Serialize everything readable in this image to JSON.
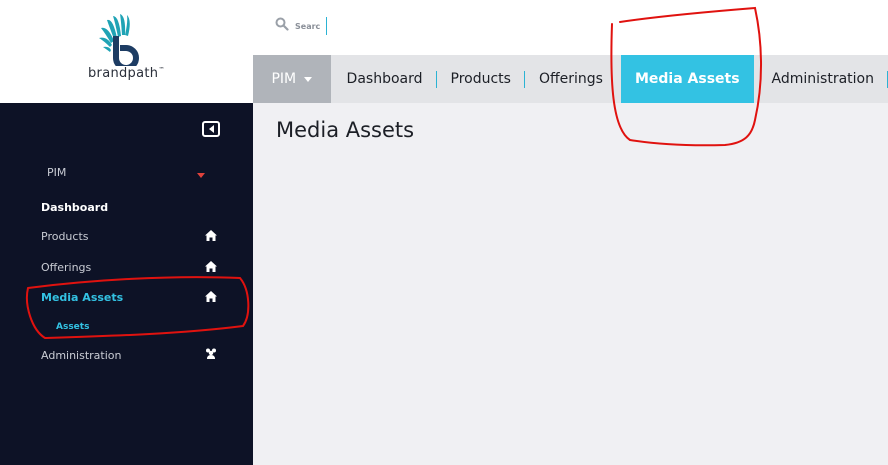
{
  "logo": {
    "text": "brandpath",
    "trademark": "™"
  },
  "search": {
    "placeholder": "Searc"
  },
  "nav": {
    "pim_label": "PIM",
    "items": [
      "Dashboard",
      "Products",
      "Offerings",
      "Media Assets",
      "Administration"
    ],
    "active": "Media Assets"
  },
  "sidebar": {
    "group_label": "PIM",
    "items": [
      {
        "label": "Dashboard",
        "icon": ""
      },
      {
        "label": "Products",
        "icon": "home-icon"
      },
      {
        "label": "Offerings",
        "icon": "home-icon"
      },
      {
        "label": "Media Assets",
        "icon": "home-icon"
      },
      {
        "label": "Administration",
        "icon": "users-icon"
      }
    ],
    "sub_item": "Assets"
  },
  "main": {
    "title": "Media Assets"
  },
  "colors": {
    "accent": "#33c2e3",
    "sidebar_bg": "#0d1226",
    "annotation": "#e0120f",
    "caret_red": "#e0423c"
  }
}
